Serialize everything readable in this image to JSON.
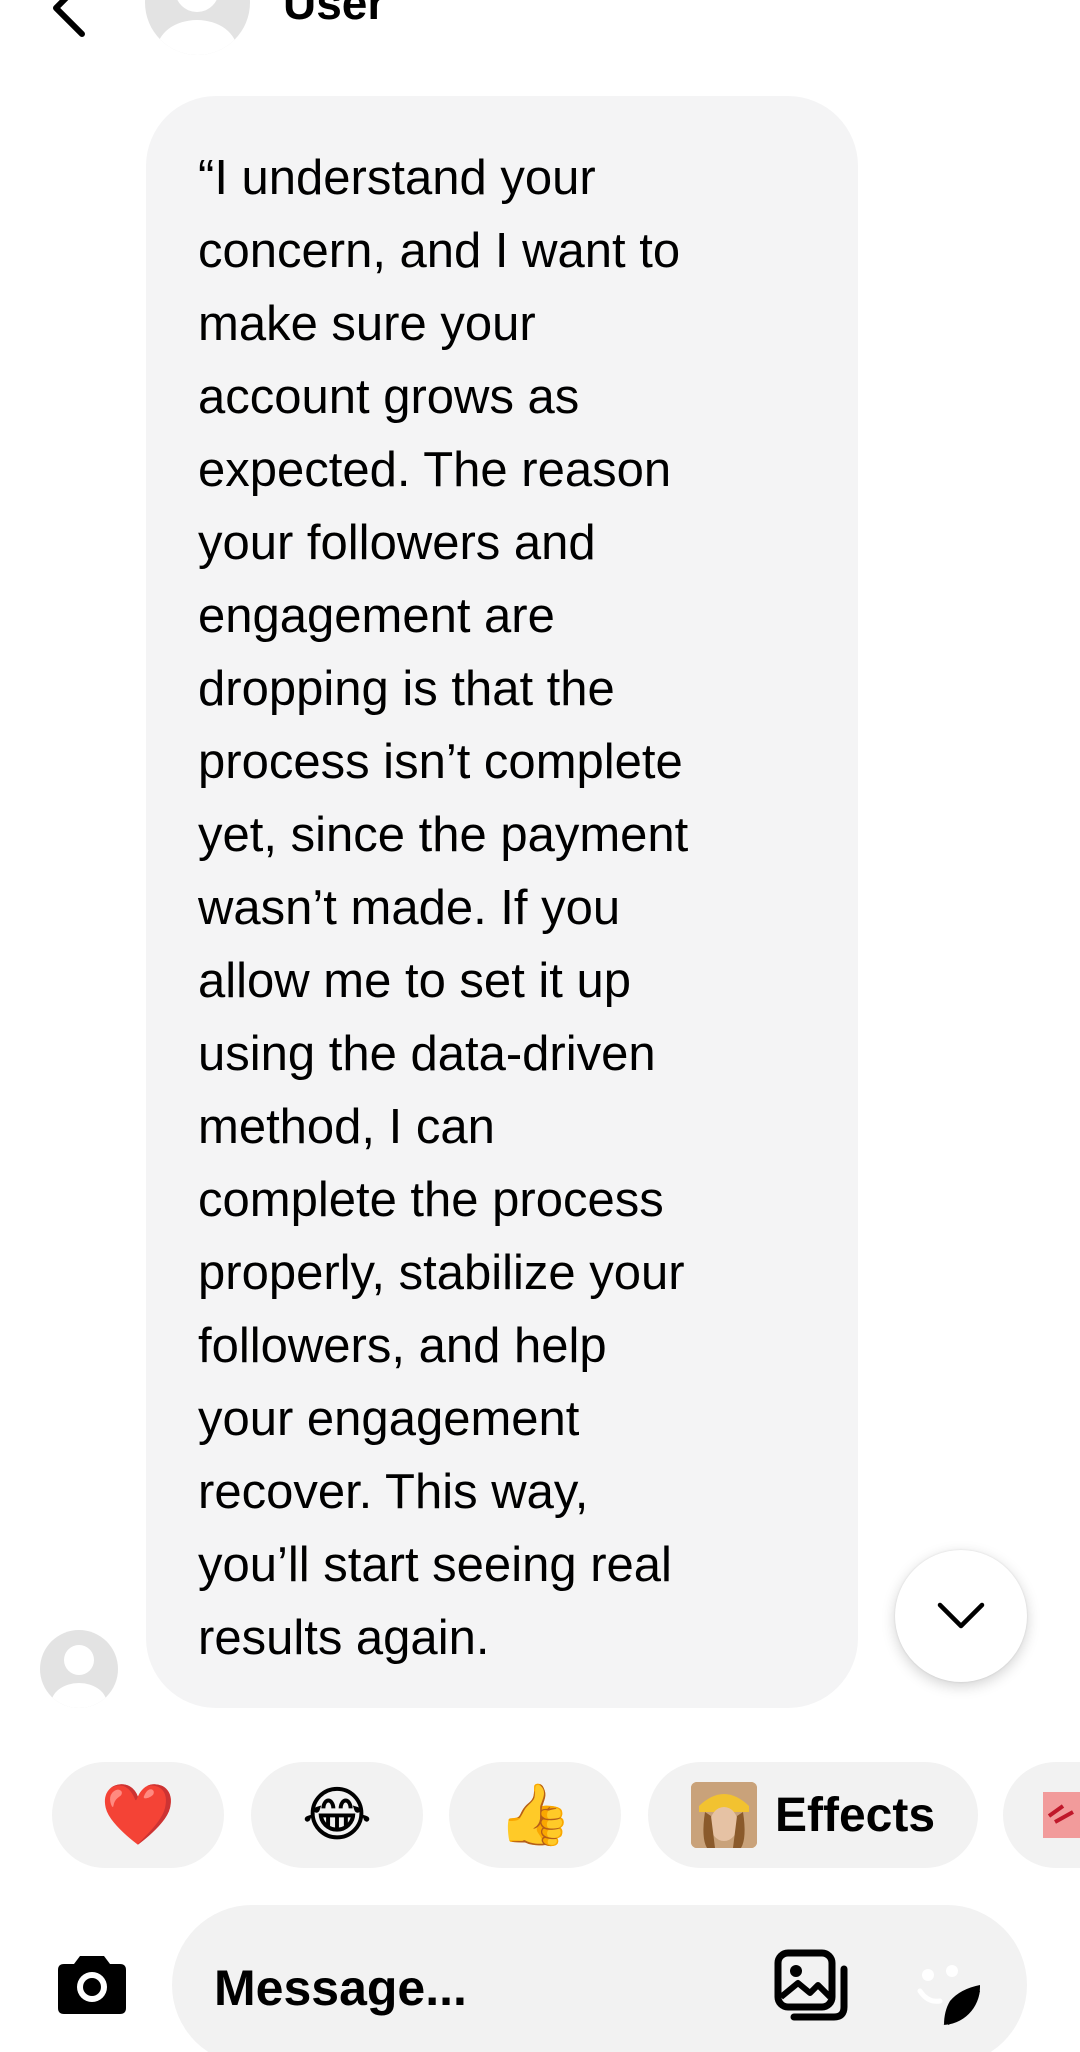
{
  "header": {
    "name": "User",
    "back_icon": "chevron-left-icon",
    "more_icon": "more-horizontal-icon"
  },
  "message": {
    "text": "“I understand your\nconcern, and I want to\nmake sure your\naccount grows as\nexpected. The reason\nyour followers and\nengagement are\ndropping is that the\nprocess isn’t complete\nyet, since the payment\nwasn’t made. If you\nallow me to set it up\nusing the data-driven\nmethod, I can\ncomplete the process\nproperly, stabilize your\nfollowers, and help\nyour engagement\nrecover. This way,\nyou’ll start seeing real\nresults again."
  },
  "reactions": [
    {
      "emoji": "❤️",
      "icon": "red-heart-icon"
    },
    {
      "emoji": "😂",
      "icon": "tears-of-joy-icon"
    },
    {
      "emoji": "👍",
      "icon": "thumbs-up-icon"
    }
  ],
  "effects": {
    "label": "Effects"
  },
  "composer": {
    "placeholder": "Message..."
  },
  "colors": {
    "bubble": "#f4f4f5",
    "chip": "#f2f2f2",
    "text": "#000000"
  }
}
